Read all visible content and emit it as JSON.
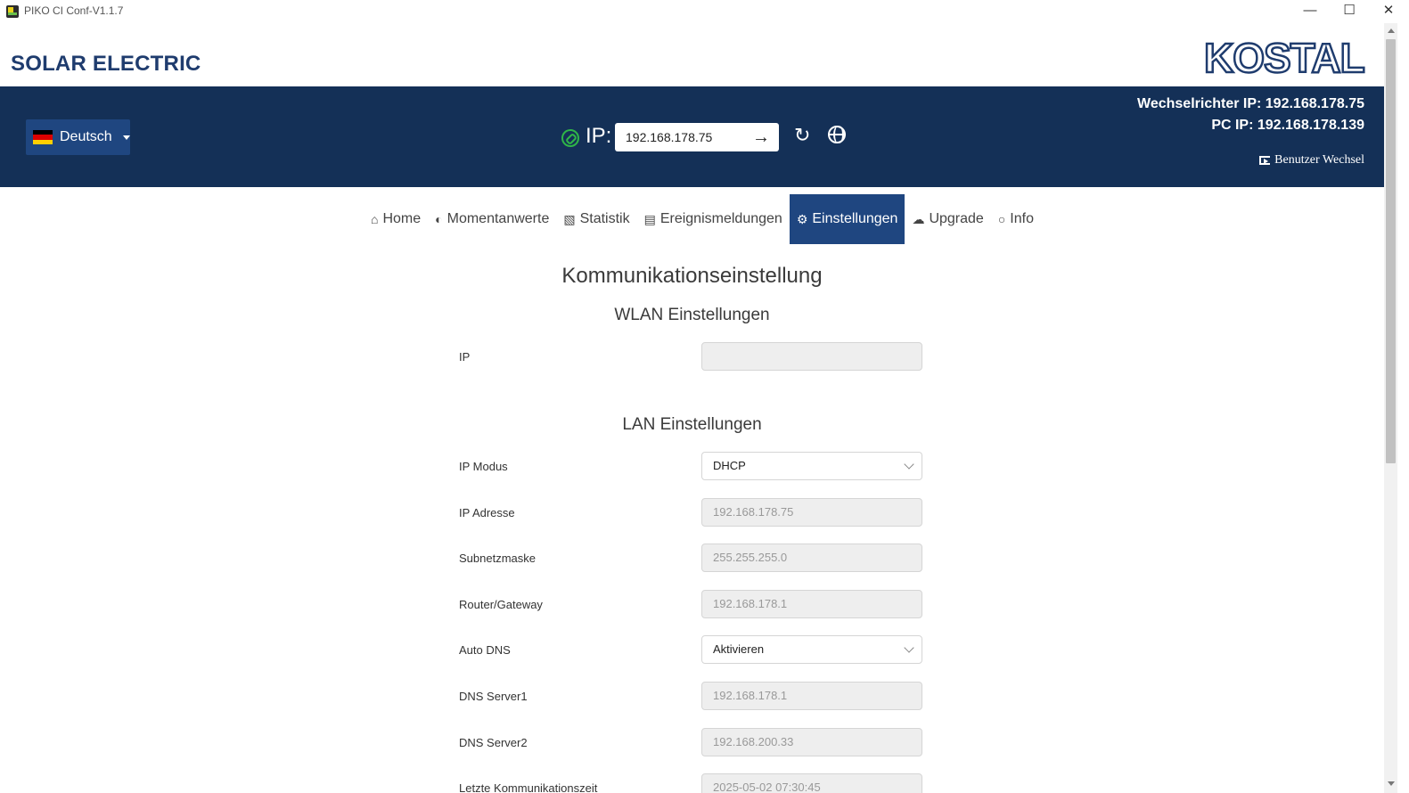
{
  "window": {
    "title": "PIKO CI Conf-V1.1.7"
  },
  "header": {
    "brand": "SOLAR ELECTRIC",
    "logo": "KOSTAL",
    "language": {
      "selected": "Deutsch",
      "flag": "de"
    },
    "ip_label": "IP:",
    "ip_value": "192.168.178.75",
    "inverter_ip": "Wechselrichter IP: 192.168.178.75",
    "pc_ip": "PC IP: 192.168.178.139",
    "user_switch": "Benutzer Wechsel"
  },
  "nav": {
    "items": [
      {
        "label": "Home",
        "icon": "home-icon"
      },
      {
        "label": "Momentanwerte",
        "icon": "dashboard-icon"
      },
      {
        "label": "Statistik",
        "icon": "bar-chart-icon"
      },
      {
        "label": "Ereignismeldungen",
        "icon": "document-icon"
      },
      {
        "label": "Einstellungen",
        "icon": "gear-icon",
        "active": true
      },
      {
        "label": "Upgrade",
        "icon": "cloud-upload-icon"
      },
      {
        "label": "Info",
        "icon": "lightbulb-icon"
      }
    ]
  },
  "content": {
    "title": "Kommunikationseinstellung",
    "wlan": {
      "heading": "WLAN Einstellungen",
      "fields": [
        {
          "label": "IP",
          "value": ""
        }
      ]
    },
    "lan": {
      "heading": "LAN Einstellungen",
      "fields": [
        {
          "label": "IP Modus",
          "value": "DHCP"
        },
        {
          "label": "IP Adresse",
          "value": "192.168.178.75"
        },
        {
          "label": "Subnetzmaske",
          "value": "255.255.255.0"
        },
        {
          "label": "Router/Gateway",
          "value": "192.168.178.1"
        },
        {
          "label": "Auto DNS",
          "value": "Aktivieren"
        },
        {
          "label": "DNS Server1",
          "value": "192.168.178.1"
        },
        {
          "label": "DNS Server2",
          "value": "192.168.200.33"
        },
        {
          "label": "Letzte Kommunikationszeit",
          "value": "2025-05-02 07:30:45"
        }
      ]
    }
  },
  "colors": {
    "primary": "#143057",
    "accent": "#1f4680",
    "link_ok": "#2fb548"
  }
}
